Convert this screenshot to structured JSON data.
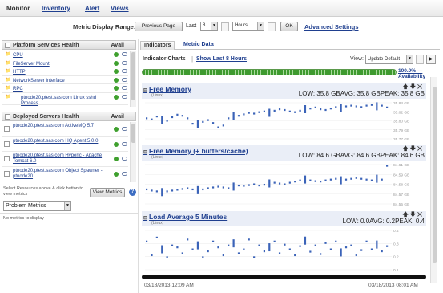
{
  "nav": {
    "monitor": "Monitor",
    "inventory": "Inventory",
    "alert": "Alert",
    "views": "Views"
  },
  "range": {
    "label": "Metric Display Range:",
    "previous_page": "Previous Page",
    "last_label": "Last",
    "last_value": "8",
    "unit_value": "Hours",
    "ok": "OK",
    "advanced": "Advanced Settings"
  },
  "platform_health": {
    "title": "Platform Services Health",
    "avail": "Avail",
    "items": [
      {
        "label": "CPU"
      },
      {
        "label": "FileServer Mount"
      },
      {
        "label": "HTTP"
      },
      {
        "label": "NetworkServer Interface"
      },
      {
        "label": "RPC"
      },
      {
        "label": "ptnode20.ptest.sas.com Linux sshd Process"
      }
    ]
  },
  "deployed_health": {
    "title": "Deployed Servers Health",
    "avail": "Avail",
    "items": [
      {
        "label": "ptnode20.ptest.sas.com ActiveMQ 5.7"
      },
      {
        "label": "ptnode20.ptest.sas.com HQ Agent 5.0.0"
      },
      {
        "label": "ptnode20.ptest.sas.com Hyperic - Apache Tomcat 6.0"
      },
      {
        "label": "ptnode20.ptest.sas.com Object Spawner - ptnode20"
      }
    ],
    "hint": "Select Resources above & click button to view metrics",
    "view_metrics": "View Metrics"
  },
  "problem_metrics": {
    "select": "Problem Metrics",
    "empty": "No metrics to display"
  },
  "tabs": {
    "indicators": "Indicators",
    "metric_data": "Metric Data"
  },
  "indicator_bar": {
    "charts_label": "Indicator Charts",
    "show_last": "Show Last 8 Hours",
    "view_label": "View:",
    "view_value": "Update Default",
    "availability_pct": "100.0% —",
    "availability_label": "Availability"
  },
  "charts": [
    {
      "title": "Free Memory",
      "unit": "(Linux)",
      "low_label": "LOW:",
      "low": "35.8 GB",
      "avg_label": "AVG:",
      "avg": "35.8 GB",
      "peak_label": "PEAK:",
      "peak": "35.8 GB",
      "yticks": [
        "35.84 GB",
        "35.82 GB",
        "35.80 GB",
        "35.79 GB",
        "35.77 GB"
      ]
    },
    {
      "title": "Free Memory (+ buffers/cache)",
      "unit": "(Linux)",
      "low_label": "LOW:",
      "low": "84.6 GB",
      "avg_label": "AVG:",
      "avg": "84.6 GB",
      "peak_label": "PEAK:",
      "peak": "84.6 GB",
      "yticks": [
        "84.61 GB",
        "84.59 GB",
        "84.58 GB",
        "84.57 GB",
        "84.55 GB"
      ]
    },
    {
      "title": "Load Average 5 Minutes",
      "unit": "(Linux)",
      "low_label": "LOW:",
      "low": "0.0",
      "avg_label": "AVG:",
      "avg": "0.2",
      "peak_label": "PEAK:",
      "peak": "0.4",
      "yticks": [
        "0.4",
        "0.3",
        "0.2",
        "0.1"
      ]
    }
  ],
  "time": {
    "start": "03/18/2013 12:09 AM",
    "end": "03/18/2013 08:01 AM"
  },
  "icons": {
    "folder": "folder-icon",
    "status": "status-ok-icon",
    "bubble": "comment-icon"
  },
  "colors": {
    "link": "#1f3f8f",
    "ok": "#3fa02e",
    "series": "#3b63b8"
  }
}
